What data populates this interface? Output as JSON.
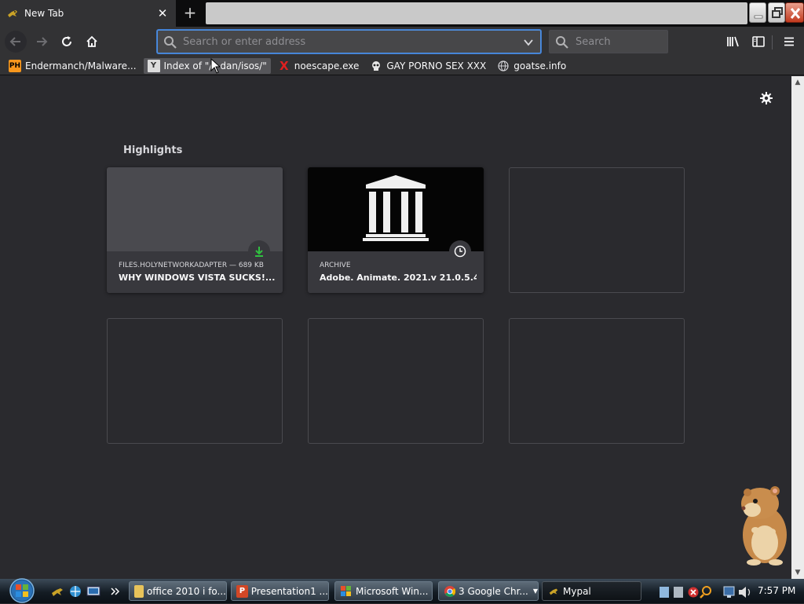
{
  "tab": {
    "title": "New Tab",
    "close_glyph": "✕"
  },
  "toolbar": {
    "new_tab_glyph": "+",
    "urlbar_placeholder": "Search or enter address",
    "searchbar_placeholder": "Search"
  },
  "bookmarks": [
    {
      "label": "Endermanch/Malware...",
      "icon": "PH"
    },
    {
      "label": "Index of \"/~dan/isos/\"",
      "icon": "Y"
    },
    {
      "label": "noescape.exe",
      "icon": "X"
    },
    {
      "label": "GAY PORNO SEX XXX",
      "icon": "skull-icon"
    },
    {
      "label": "goatse.info",
      "icon": "globe-icon"
    }
  ],
  "page": {
    "section_title": "Highlights",
    "cards": [
      {
        "meta": "FILES.HOLYNETWORKADAPTER — 689 KB",
        "title": "WHY WINDOWS VISTA SUCKS!....",
        "badge": "download-icon"
      },
      {
        "meta": "ARCHIVE",
        "title": "Adobe. Animate. 2021.v 21.0.5.4...",
        "badge": "clock-icon"
      }
    ]
  },
  "taskbar": {
    "tasks": [
      {
        "label": "office 2010 i fo...",
        "icon": "folder-icon"
      },
      {
        "label": "Presentation1 ...",
        "icon": "P"
      },
      {
        "label": "Microsoft Win...",
        "icon": "windows-icon"
      },
      {
        "label": "3 Google Chr...",
        "icon": "chrome-icon"
      },
      {
        "label": "Mypal",
        "icon": "mypal-icon"
      }
    ],
    "clock": "7:57 PM"
  },
  "colors": {
    "page_bg": "#2a2a2e",
    "toolbar_bg": "#323234",
    "tab_bg": "#0c0c0d",
    "accent": "#4f8fe0",
    "download_green": "#30c040"
  }
}
